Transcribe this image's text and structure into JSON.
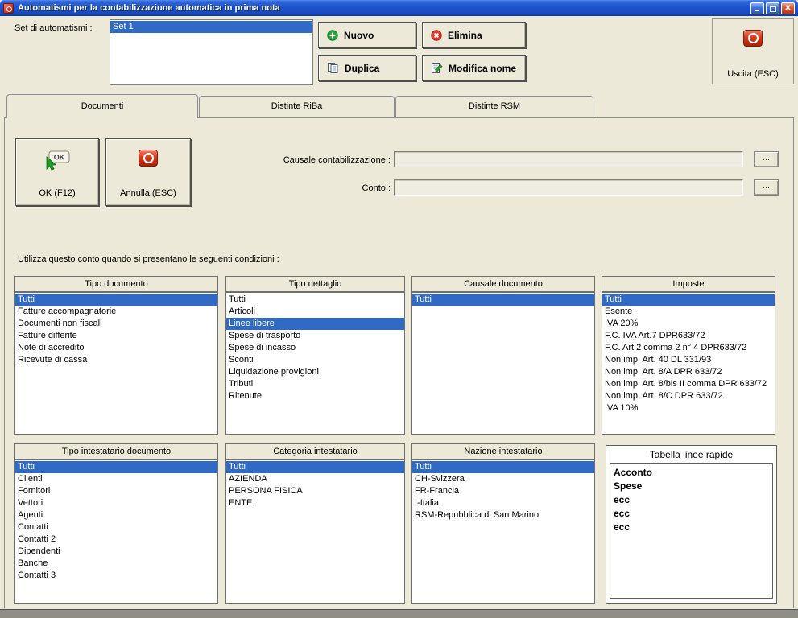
{
  "window": {
    "title": "Automatismi per la contabilizzazione automatica in prima nota"
  },
  "header": {
    "set_label": "Set di automatismi :",
    "sets": {
      "items": [
        "Set 1"
      ],
      "selected": 0
    },
    "nuovo_label": "Nuovo",
    "elimina_label": "Elimina",
    "duplica_label": "Duplica",
    "modifica_nome_label": "Modifica nome",
    "uscita_label": "Uscita (ESC)"
  },
  "tabs": {
    "documenti": "Documenti",
    "distinte_riba": "Distinte RiBa",
    "distinte_rsm": "Distinte RSM"
  },
  "form": {
    "ok_label": "OK (F12)",
    "annulla_label": "Annulla (ESC)",
    "causale_label": "Causale contabilizzazione :",
    "causale_value": "",
    "conto_label": "Conto :",
    "conto_value": "",
    "browse_label": "...",
    "conditions_text": "Utilizza questo conto quando si presentano le seguenti condizioni :"
  },
  "lists": {
    "tipo_documento": {
      "title": "Tipo documento",
      "selected": 0,
      "items": [
        "Tutti",
        "Fatture accompagnatorie",
        "Documenti non fiscali",
        "Fatture differite",
        "Note di accredito",
        "Ricevute di cassa"
      ]
    },
    "tipo_dettaglio": {
      "title": "Tipo dettaglio",
      "selected": 2,
      "items": [
        "Tutti",
        "Articoli",
        "Linee libere",
        "Spese di trasporto",
        "Spese di incasso",
        "Sconti",
        "Liquidazione provigioni",
        "Tributi",
        "Ritenute"
      ]
    },
    "causale_documento": {
      "title": "Causale documento",
      "selected": 0,
      "items": [
        "Tutti"
      ]
    },
    "imposte": {
      "title": "Imposte",
      "selected": 0,
      "items": [
        "Tutti",
        "Esente",
        "IVA 20%",
        "F.C. IVA Art.7 DPR633/72",
        "F.C. Art.2 comma 2 n° 4 DPR633/72",
        "Non imp. Art. 40 DL 331/93",
        "Non imp. Art. 8/A DPR 633/72",
        "Non imp. Art. 8/bis II comma DPR 633/72",
        "Non imp. Art. 8/C DPR 633/72",
        "IVA 10%"
      ]
    },
    "tipo_intestatario": {
      "title": "Tipo intestatario documento",
      "selected": 0,
      "items": [
        "Tutti",
        "Clienti",
        "Fornitori",
        "Vettori",
        "Agenti",
        "Contatti",
        "Contatti 2",
        "Dipendenti",
        "Banche",
        "Contatti 3"
      ]
    },
    "categoria_intestatario": {
      "title": "Categoria intestatario",
      "selected": 0,
      "items": [
        "Tutti",
        "AZIENDA",
        "PERSONA FISICA",
        "ENTE"
      ]
    },
    "nazione_intestatario": {
      "title": "Nazione intestatario",
      "selected": 0,
      "items": [
        "Tutti",
        "CH-Svizzera",
        "FR-Francia",
        "I-Italia",
        "RSM-Repubblica di San Marino"
      ]
    }
  },
  "tabella_linee_rapide": {
    "title": "Tabella linee rapide",
    "items": [
      "Acconto",
      "Spese",
      "ecc",
      "ecc",
      "ecc"
    ]
  },
  "colors": {
    "window_bg": "#ECE9D8",
    "selection_blue": "#316AC5",
    "titlebar_blue": "#1D53CC",
    "accent_red": "#C8341C",
    "accent_green": "#23A638"
  }
}
